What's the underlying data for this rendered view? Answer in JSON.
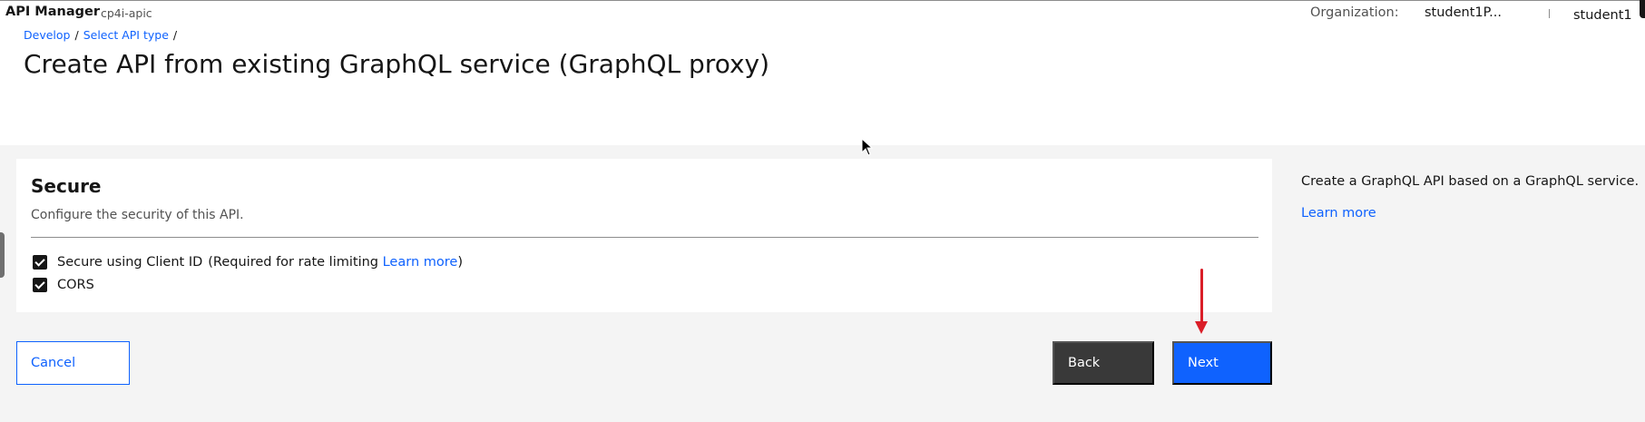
{
  "header": {
    "product_name": "API Manager",
    "instance_name": "cp4i-apic",
    "org_label": "Organization:",
    "org_value": "student1P...",
    "user_name": "student1"
  },
  "breadcrumb": {
    "items": [
      "Develop",
      "Select API type"
    ],
    "separator": "/"
  },
  "page": {
    "title": "Create API from existing GraphQL service (GraphQL proxy)"
  },
  "secure_card": {
    "title": "Secure",
    "description": "Configure the security of this API.",
    "options": [
      {
        "label": "Secure using Client ID",
        "checked": true,
        "note_prefix": "(Required for rate limiting",
        "note_link": "Learn more",
        "note_suffix": ")"
      },
      {
        "label": "CORS",
        "checked": true
      }
    ]
  },
  "side_panel": {
    "description": "Create a GraphQL API based on a GraphQL service.",
    "link": "Learn more"
  },
  "actions": {
    "cancel": "Cancel",
    "back": "Back",
    "next": "Next"
  },
  "colors": {
    "primary": "#0f62fe",
    "secondary": "#393939",
    "annotation_arrow": "#da1e28",
    "background": "#f4f4f4"
  },
  "icons": [
    "checkbox-checked-icon",
    "red-arrow-annotation",
    "mouse-cursor-icon"
  ]
}
